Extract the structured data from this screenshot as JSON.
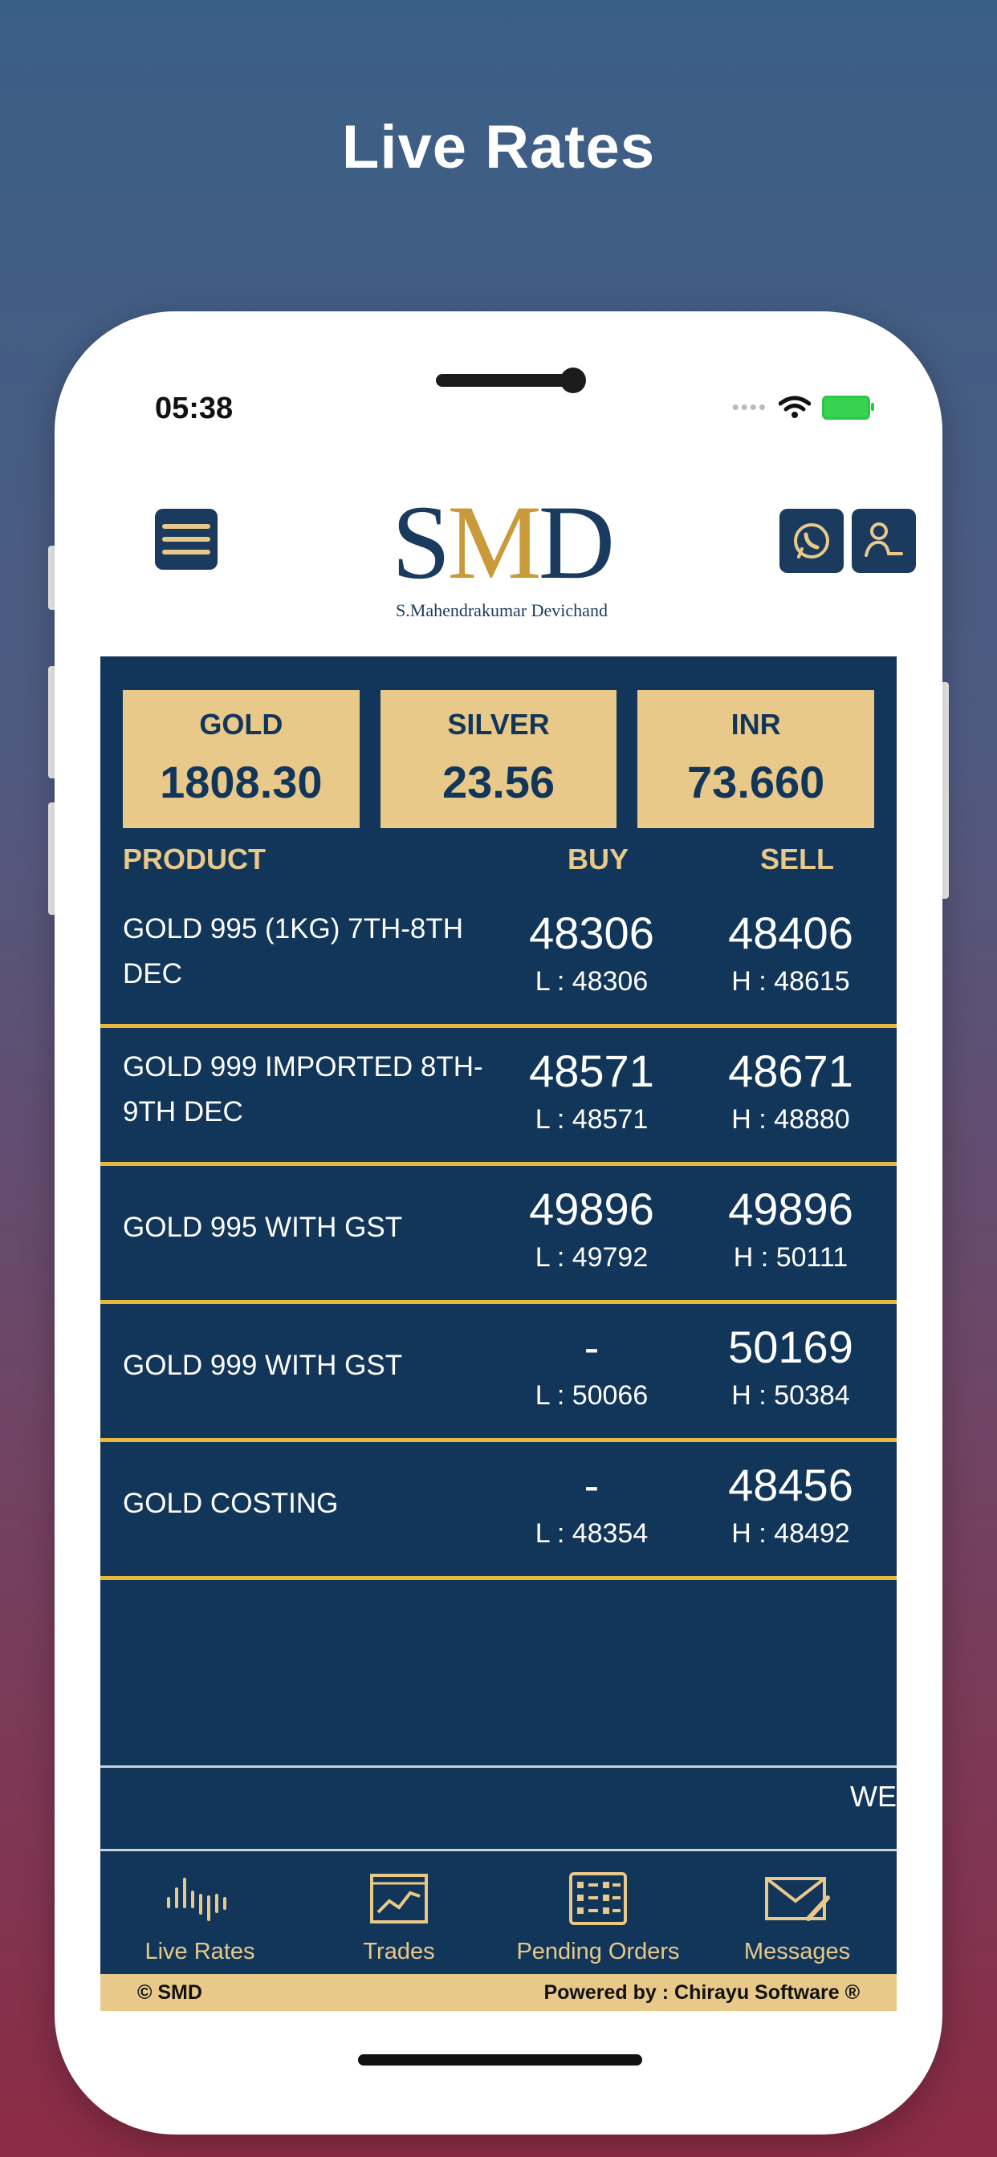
{
  "headline": "Live Rates",
  "status": {
    "time": "05:38"
  },
  "logo": {
    "title_left": "S",
    "title_mid": "M",
    "title_right": "D",
    "subtitle": "S.Mahendrakumar Devichand"
  },
  "tickers": [
    {
      "label": "GOLD",
      "value": "1808.30"
    },
    {
      "label": "SILVER",
      "value": "23.56"
    },
    {
      "label": "INR",
      "value": "73.660"
    }
  ],
  "table": {
    "headers": {
      "product": "PRODUCT",
      "buy": "BUY",
      "sell": "SELL"
    },
    "rows": [
      {
        "name": "GOLD 995 (1KG) 7TH-8TH DEC",
        "buy": "48306",
        "low": "L : 48306",
        "sell": "48406",
        "high": "H : 48615"
      },
      {
        "name": "GOLD 999 IMPORTED 8TH-9TH DEC",
        "buy": "48571",
        "low": "L : 48571",
        "sell": "48671",
        "high": "H : 48880"
      },
      {
        "name": "GOLD 995 WITH GST",
        "buy": "49896",
        "low": "L : 49792",
        "sell": "49896",
        "high": "H : 50111"
      },
      {
        "name": "GOLD 999 WITH GST",
        "buy": "-",
        "low": "L : 50066",
        "sell": "50169",
        "high": "H : 50384"
      },
      {
        "name": "GOLD COSTING",
        "buy": "-",
        "low": "L : 48354",
        "sell": "48456",
        "high": "H : 48492"
      }
    ]
  },
  "marquee": "WE",
  "tabs": [
    {
      "label": "Live Rates",
      "icon": "signal-icon"
    },
    {
      "label": "Trades",
      "icon": "chart-icon"
    },
    {
      "label": "Pending Orders",
      "icon": "list-icon"
    },
    {
      "label": "Messages",
      "icon": "envelope-icon"
    }
  ],
  "footer": {
    "left": "© SMD",
    "right": "Powered by : Chirayu Software ®"
  },
  "colors": {
    "navy": "#12365a",
    "gold": "#e9c98a",
    "accent_line": "#e8b83c"
  }
}
